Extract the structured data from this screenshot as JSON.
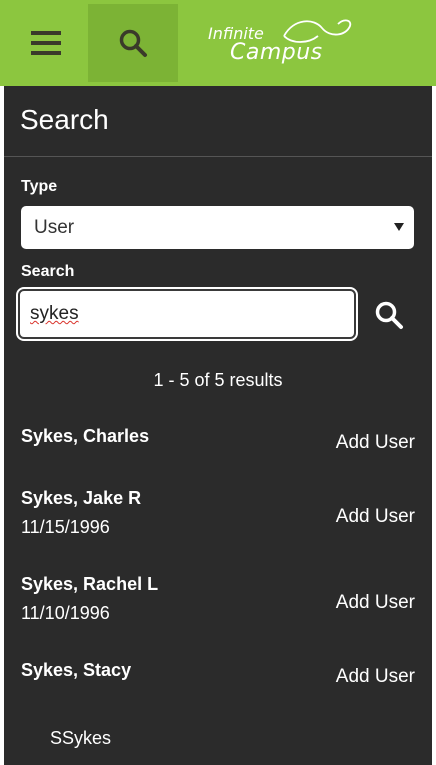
{
  "header": {
    "menu_icon": "hamburger-menu-icon",
    "search_icon": "search-icon",
    "logo_line1": "Infinite",
    "logo_line2": "Campus",
    "bar_color": "#8cc63f",
    "active_button_color": "#7cb335"
  },
  "panel": {
    "title": "Search",
    "background": "#2b2b2b"
  },
  "form": {
    "type_label": "Type",
    "type_selected": "User",
    "search_label": "Search",
    "search_value": "sykes",
    "search_button_icon": "search-icon"
  },
  "results": {
    "summary": "1 - 5 of 5 results",
    "add_label": "Add User",
    "items": [
      {
        "name": "Sykes, Charles",
        "dob": ""
      },
      {
        "name": "Sykes, Jake R",
        "dob": "11/15/1996"
      },
      {
        "name": "Sykes, Rachel L",
        "dob": "11/10/1996"
      },
      {
        "name": "Sykes, Stacy",
        "dob": ""
      }
    ],
    "sub_item": "SSykes"
  }
}
